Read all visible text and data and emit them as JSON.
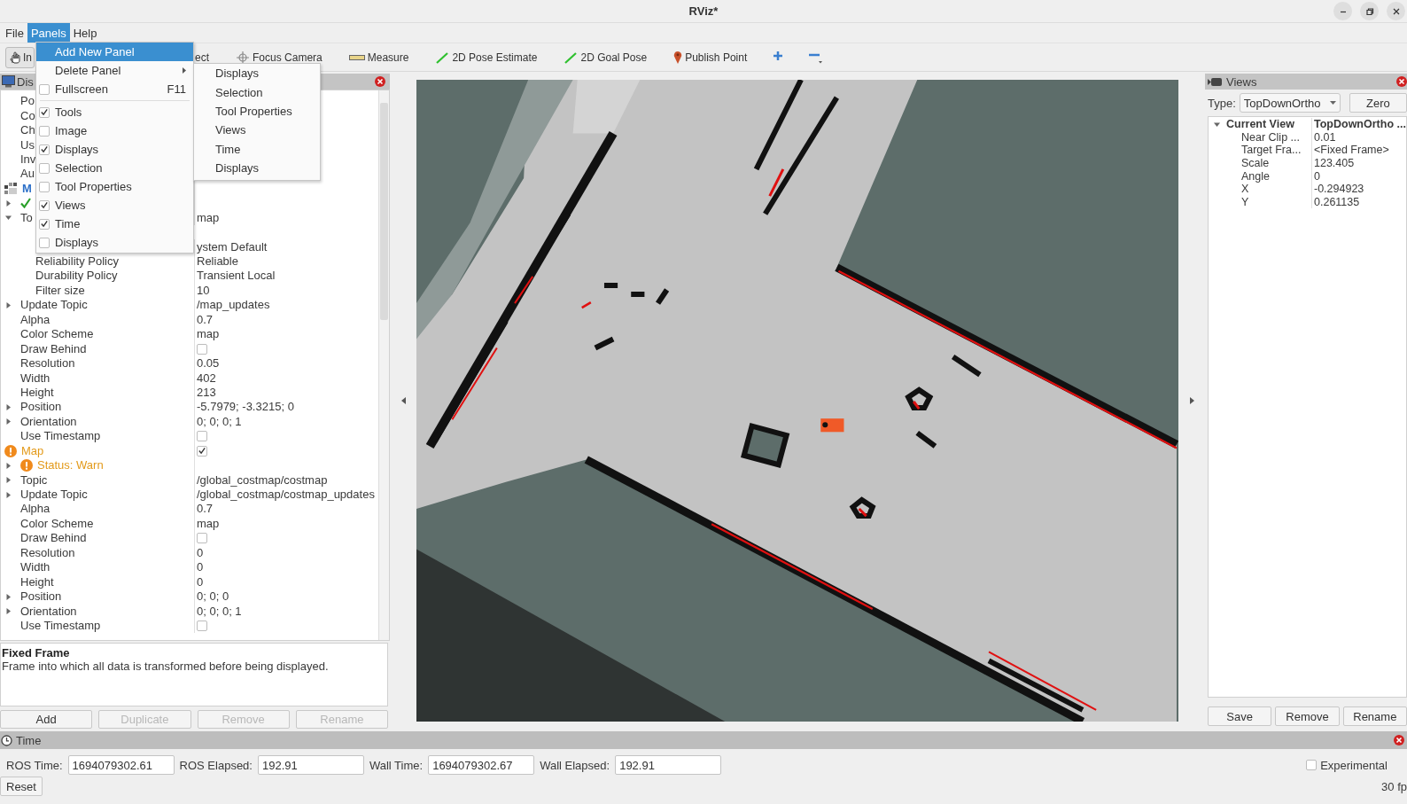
{
  "window": {
    "title": "RViz*"
  },
  "menubar": [
    {
      "label": "File",
      "selected": false
    },
    {
      "label": "Panels",
      "selected": true
    },
    {
      "label": "Help",
      "selected": false
    }
  ],
  "toolbar": [
    {
      "kind": "interact",
      "label": "In",
      "selected": true
    },
    {
      "kind": "select",
      "label": "ect",
      "selected": false
    },
    {
      "kind": "focus",
      "label": "Focus Camera",
      "selected": false
    },
    {
      "kind": "measure",
      "label": "Measure",
      "selected": false
    },
    {
      "kind": "pose",
      "label": "2D Pose Estimate",
      "selected": false
    },
    {
      "kind": "goal",
      "label": "2D Goal Pose",
      "selected": false
    },
    {
      "kind": "point",
      "label": "Publish Point",
      "selected": false
    },
    {
      "kind": "add"
    },
    {
      "kind": "remove"
    }
  ],
  "panels_menu": {
    "items": [
      {
        "kind": "action",
        "label": "Add New Panel",
        "selected": true
      },
      {
        "kind": "submenu",
        "label": "Delete Panel",
        "selected": false
      },
      {
        "kind": "check",
        "label": "Fullscreen",
        "shortcut": "F11",
        "checked": false,
        "selected": false
      },
      {
        "kind": "separator"
      },
      {
        "kind": "check",
        "label": "Tools",
        "checked": true,
        "selected": false
      },
      {
        "kind": "check",
        "label": "Image",
        "checked": false,
        "selected": false
      },
      {
        "kind": "check",
        "label": "Displays",
        "checked": true,
        "selected": false
      },
      {
        "kind": "check",
        "label": "Selection",
        "checked": false,
        "selected": false
      },
      {
        "kind": "check",
        "label": "Tool Properties",
        "checked": false,
        "selected": false
      },
      {
        "kind": "check",
        "label": "Views",
        "checked": true,
        "selected": false
      },
      {
        "kind": "check",
        "label": "Time",
        "checked": true,
        "selected": false
      },
      {
        "kind": "check",
        "label": "Displays",
        "checked": false,
        "selected": false
      }
    ],
    "submenu": [
      "Displays",
      "Selection",
      "Tool Properties",
      "Views",
      "Time",
      "Displays"
    ]
  },
  "displays_panel": {
    "title": "Dis",
    "tree": [
      {
        "children": [
          {
            "label": "Po"
          },
          {
            "label": "Co"
          },
          {
            "label": "Ch"
          },
          {
            "label": "Us"
          },
          {
            "label": "Inv"
          },
          {
            "label": "Au"
          }
        ]
      },
      {
        "label": "M",
        "kind": "map",
        "children": [
          {
            "kind": "ok",
            "expanded": false
          },
          {
            "label": "To",
            "value": "map",
            "expanded": true,
            "children": [
              {
                "value": "ystem Default"
              },
              {
                "label": "Reliability Policy",
                "value": "Reliable"
              },
              {
                "label": "Durability Policy",
                "value": "Transient Local"
              },
              {
                "label": "Filter size",
                "value": "10"
              }
            ]
          },
          {
            "label": "Update Topic",
            "value": "/map_updates",
            "expanded": false
          },
          {
            "label": "Alpha",
            "value": "0.7"
          },
          {
            "label": "Color Scheme",
            "value": "map"
          },
          {
            "label": "Draw Behind",
            "checked": false
          },
          {
            "label": "Resolution",
            "value": "0.05"
          },
          {
            "label": "Width",
            "value": "402"
          },
          {
            "label": "Height",
            "value": "213"
          },
          {
            "label": "Position",
            "value": "-5.7979; -3.3215; 0",
            "expanded": false
          },
          {
            "label": "Orientation",
            "value": "0; 0; 0; 1",
            "expanded": false
          },
          {
            "label": "Use Timestamp",
            "checked": false
          }
        ]
      },
      {
        "label": "Map",
        "kind": "warn",
        "checked": true,
        "children": [
          {
            "label": "Status: Warn",
            "kind": "warn",
            "expanded": false
          },
          {
            "label": "Topic",
            "value": "/global_costmap/costmap",
            "expanded": false
          },
          {
            "label": "Update Topic",
            "value": "/global_costmap/costmap_updates",
            "expanded": false
          },
          {
            "label": "Alpha",
            "value": "0.7"
          },
          {
            "label": "Color Scheme",
            "value": "map"
          },
          {
            "label": "Draw Behind",
            "checked": false
          },
          {
            "label": "Resolution",
            "value": "0"
          },
          {
            "label": "Width",
            "value": "0"
          },
          {
            "label": "Height",
            "value": "0"
          },
          {
            "label": "Position",
            "value": "0; 0; 0",
            "expanded": false
          },
          {
            "label": "Orientation",
            "value": "0; 0; 0; 1",
            "expanded": false
          },
          {
            "label": "Use Timestamp",
            "checked": false
          }
        ]
      }
    ],
    "description": {
      "title": "Fixed Frame",
      "text": "Frame into which all data is transformed before being displayed."
    },
    "buttons": [
      {
        "label": "Add",
        "disabled": false
      },
      {
        "label": "Duplicate",
        "disabled": true
      },
      {
        "label": "Remove",
        "disabled": true
      },
      {
        "label": "Rename",
        "disabled": true
      }
    ]
  },
  "views_panel": {
    "title": "Views",
    "type_label": "Type:",
    "type_value": "TopDownOrtho",
    "zero": "Zero",
    "tree": [
      {
        "label": "Current View",
        "value": "TopDownOrtho ...",
        "expanded": true,
        "children": [
          {
            "label": "Near Clip ...",
            "value": "0.01"
          },
          {
            "label": "Target Fra...",
            "value": "<Fixed Frame>"
          },
          {
            "label": "Scale",
            "value": "123.405"
          },
          {
            "label": "Angle",
            "value": "0"
          },
          {
            "label": "X",
            "value": "-0.294923"
          },
          {
            "label": "Y",
            "value": "0.261135"
          }
        ]
      }
    ],
    "buttons": [
      "Save",
      "Remove",
      "Rename"
    ]
  },
  "time_panel": {
    "title": "Time",
    "fields": [
      {
        "label": "ROS Time:",
        "value": "1694079302.61"
      },
      {
        "label": "ROS Elapsed:",
        "value": "192.91"
      },
      {
        "label": "Wall Time:",
        "value": "1694079302.67"
      },
      {
        "label": "Wall Elapsed:",
        "value": "192.91"
      }
    ],
    "experimental": {
      "label": "Experimental",
      "checked": false
    },
    "reset": "Reset",
    "fps": "30 fp"
  }
}
